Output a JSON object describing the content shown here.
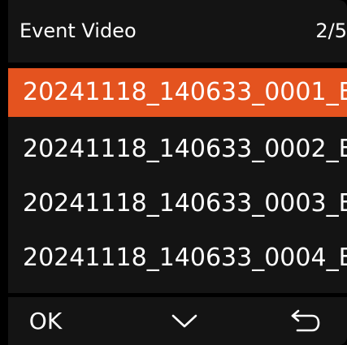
{
  "header": {
    "title": "Event Video",
    "page_indicator": "2/5"
  },
  "file_list": {
    "selected_index": 0,
    "items": [
      {
        "label": "20241118_140633_0001_E..."
      },
      {
        "label": "20241118_140633_0002_E..."
      },
      {
        "label": "20241118_140633_0003_E..."
      },
      {
        "label": "20241118_140633_0004_E..."
      }
    ]
  },
  "footer": {
    "ok_label": "OK",
    "down_icon": "chevron-down-icon",
    "back_icon": "return-arrow-icon"
  },
  "colors": {
    "selected_background": "#e4531f",
    "panel_background": "#141414",
    "text": "#ffffff"
  }
}
